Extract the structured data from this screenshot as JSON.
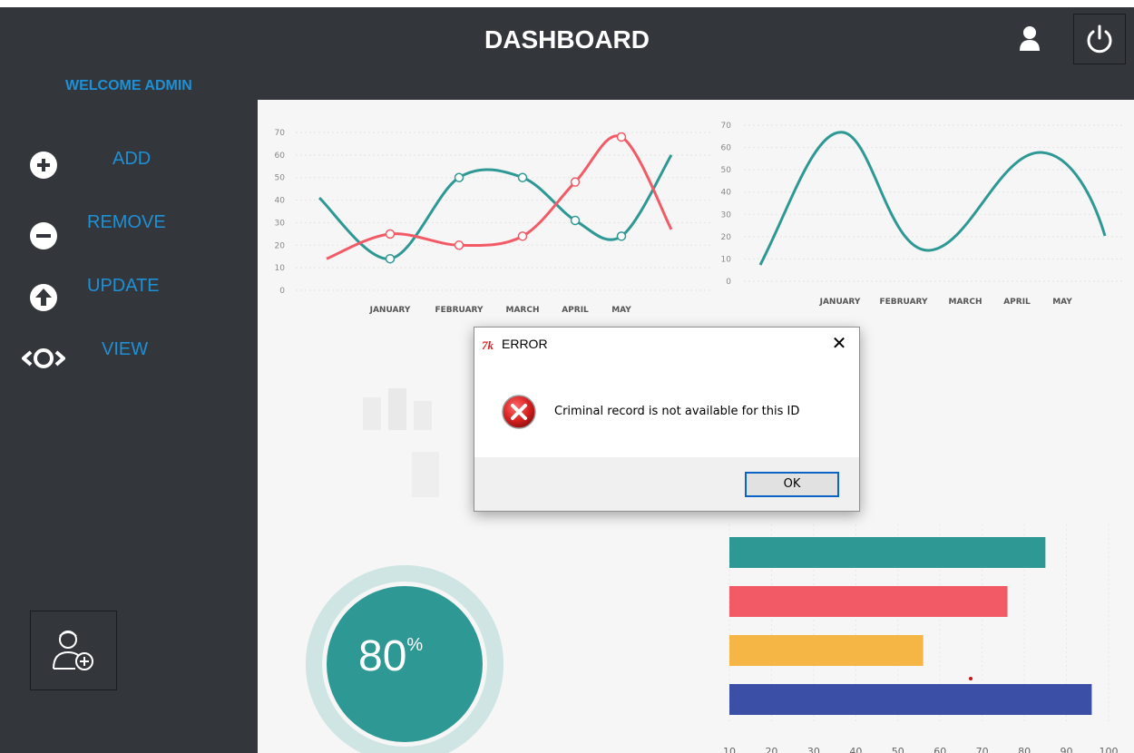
{
  "header": {
    "title": "DASHBOARD",
    "user_icon": "user-icon",
    "power_icon": "power-icon"
  },
  "sidebar": {
    "welcome": "WELCOME ADMIN",
    "items": [
      {
        "label": "ADD",
        "icon": "plus-circle-icon"
      },
      {
        "label": "REMOVE",
        "icon": "minus-circle-icon"
      },
      {
        "label": "UPDATE",
        "icon": "arrow-up-circle-icon"
      },
      {
        "label": "VIEW",
        "icon": "eye-icon"
      }
    ],
    "add_user_icon": "add-user-icon"
  },
  "colors": {
    "background": "#33373c",
    "accent": "#1e90d6",
    "teal": "#2e9894",
    "red": "#f25a66",
    "yellow": "#f6b645",
    "blue": "#3a4fa5"
  },
  "chart_data": [
    {
      "type": "line",
      "categories": [
        "JANUARY",
        "FEBRUARY",
        "MARCH",
        "APRIL",
        "MAY"
      ],
      "ylim": [
        0,
        70
      ],
      "yticks": [
        0,
        10,
        20,
        30,
        40,
        50,
        60,
        70
      ],
      "series": [
        {
          "values": [
            14,
            50,
            50,
            31,
            24
          ],
          "color": "#2e9894"
        },
        {
          "values": [
            25,
            20,
            24,
            48,
            68
          ],
          "color": "#f25a66"
        }
      ]
    },
    {
      "type": "line",
      "categories": [
        "JANUARY",
        "FEBRUARY",
        "MARCH",
        "APRIL",
        "MAY"
      ],
      "ylim": [
        0,
        70
      ],
      "yticks": [
        0,
        10,
        20,
        30,
        40,
        50,
        60,
        70
      ],
      "series": [
        {
          "color": "#2e9894"
        }
      ]
    },
    {
      "type": "bar",
      "orientation": "horizontal",
      "values": [
        85,
        76,
        56,
        96
      ],
      "colors": [
        "#2e9894",
        "#f25a66",
        "#f6b645",
        "#3a4fa5"
      ],
      "xlim": [
        10,
        100
      ],
      "xticks": [
        10,
        20,
        30,
        40,
        50,
        60,
        70,
        80,
        90,
        100
      ]
    },
    {
      "type": "gauge",
      "value": 80,
      "value_label": "80",
      "unit": "%"
    }
  ],
  "dialog": {
    "title": "ERROR",
    "app_icon": "tk",
    "message": "Criminal record is not available for this ID",
    "ok_label": "OK",
    "close_label": "✕",
    "error_icon": "error-icon"
  }
}
